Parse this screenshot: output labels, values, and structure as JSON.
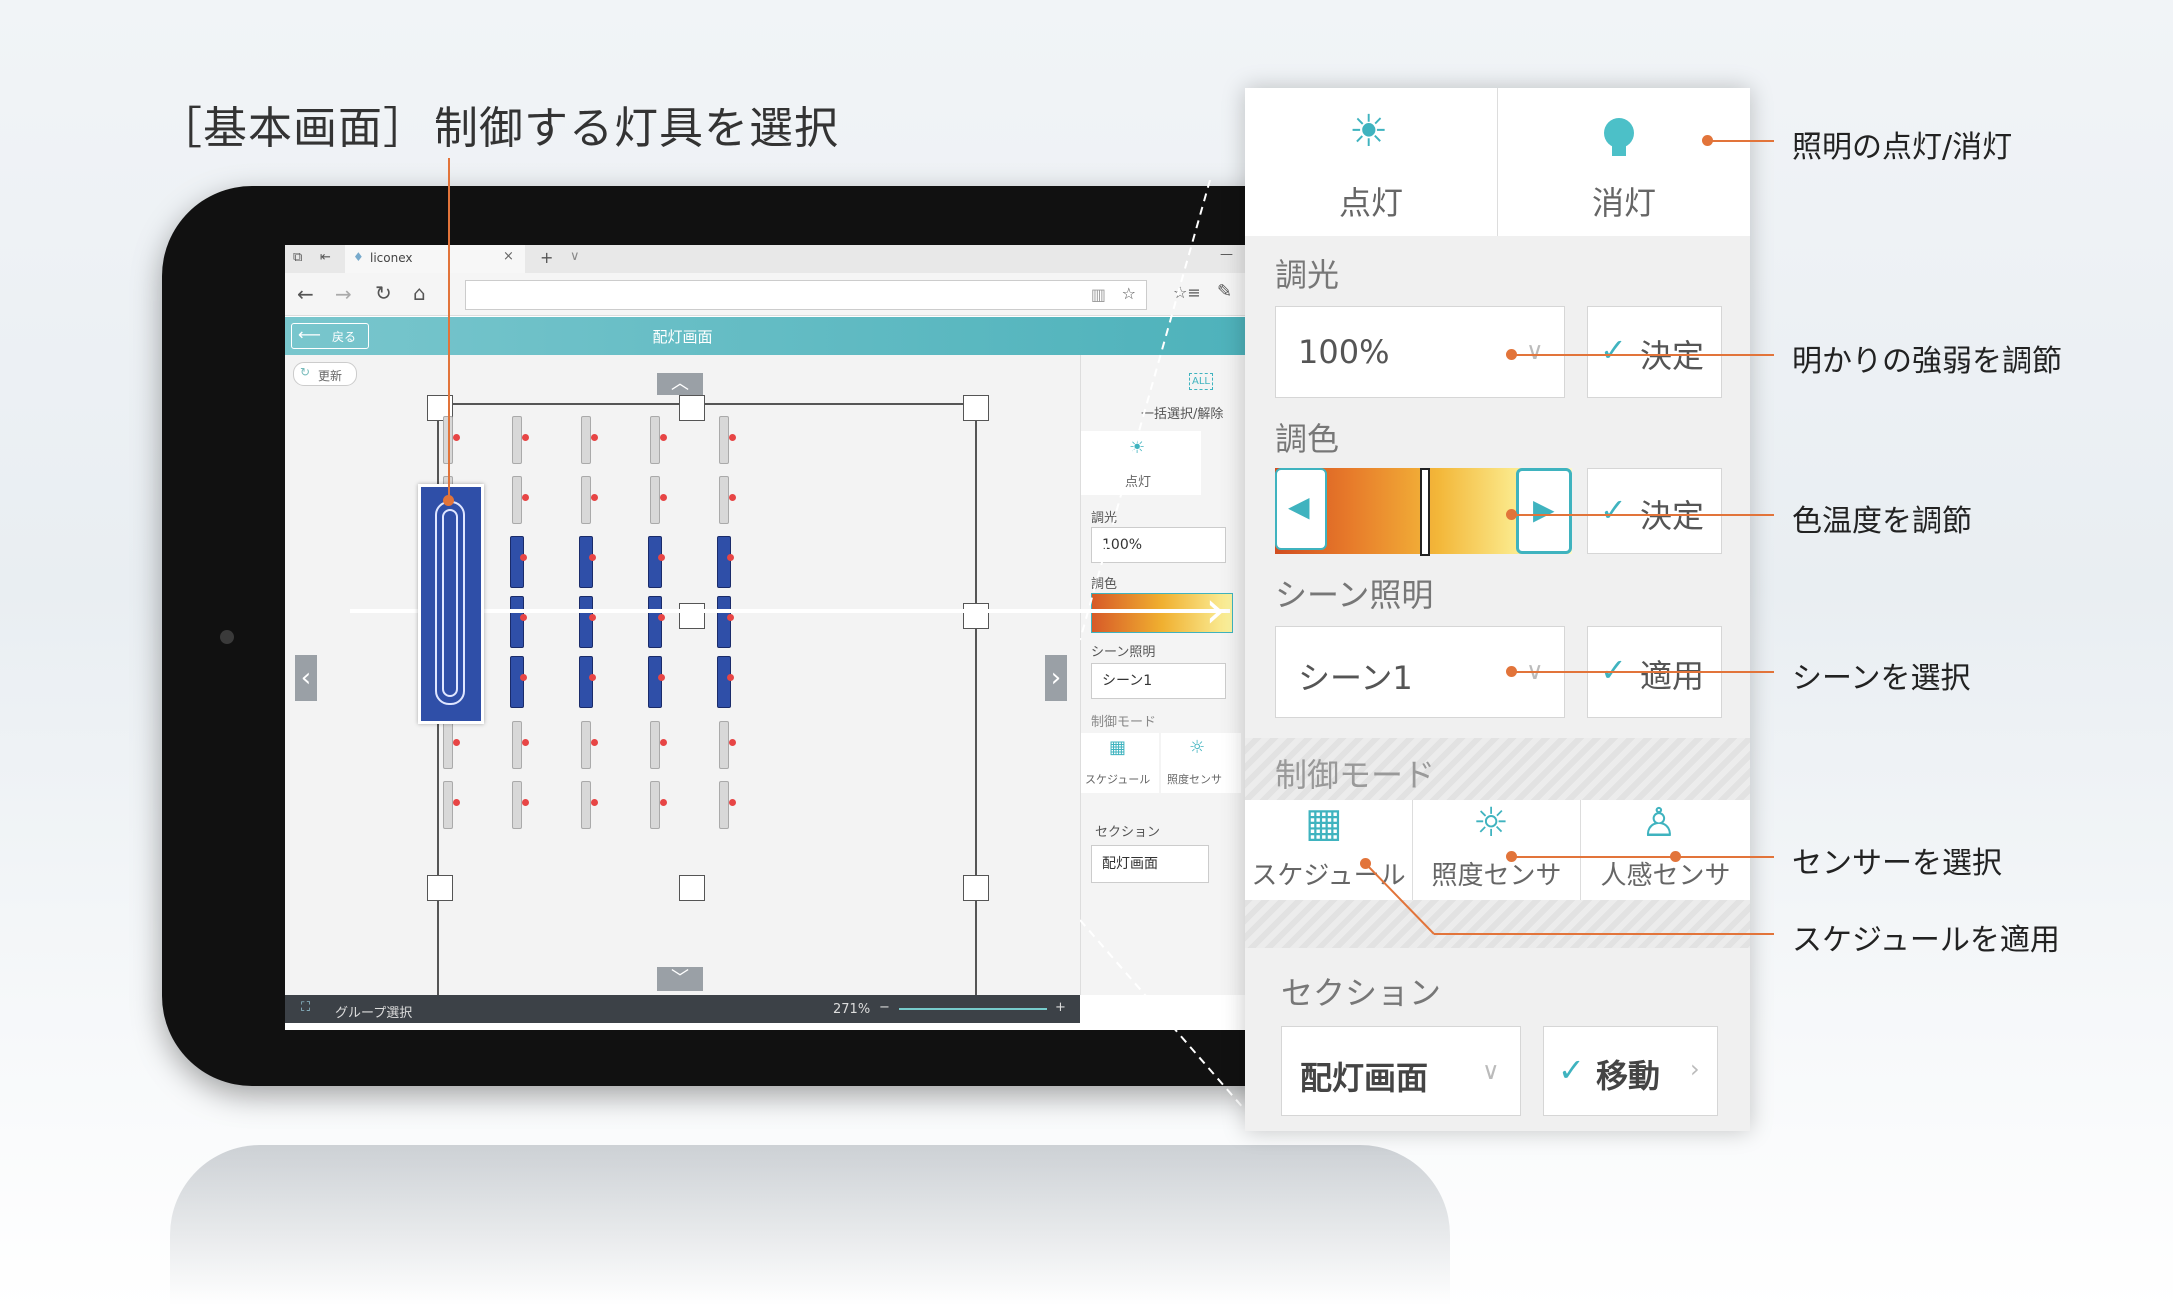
{
  "headings": {
    "screen_label": "［基本画面］",
    "select_fixture": "制御する灯具を選択"
  },
  "browser": {
    "tab_title": "liconex",
    "tab_close": "×",
    "tab_new": "+",
    "tab_more": "∨",
    "nav": {
      "back": "←",
      "forward": "→",
      "refresh": "↻",
      "home": "⌂",
      "star": "☆",
      "favorites": "☆≡",
      "pen": "✎"
    }
  },
  "app": {
    "back_button": "戻る",
    "header_title": "配灯画面",
    "refresh_button": "更新",
    "group_select": "グループ選択",
    "zoom_level": "271%",
    "zoom_minus": "−",
    "zoom_plus": "+",
    "mini_panel": {
      "select_all": "一括選択/解除",
      "all_icon_text": "ALL",
      "light_on": "点灯",
      "dimming_label": "調光",
      "dimming_value": "100%",
      "color_label": "調色",
      "scene_label": "シーン照明",
      "scene_value": "シーン1",
      "mode_label": "制御モード",
      "mode_schedule": "スケジュール",
      "mode_light_sensor": "照度センサ",
      "section_label": "セクション",
      "section_value": "配灯画面"
    }
  },
  "panel": {
    "light_on": "点灯",
    "light_off": "消灯",
    "dimming_label": "調光",
    "dimming_value": "100%",
    "decide_label": "決定",
    "color_label": "調色",
    "color_decide_label": "決定",
    "scene_label": "シーン照明",
    "scene_value": "シーン1",
    "apply_label": "適用",
    "mode_label": "制御モード",
    "mode_schedule": "スケジュール",
    "mode_light_sensor": "照度センサ",
    "mode_motion_sensor": "人感センサ",
    "section_label": "セクション",
    "section_value": "配灯画面",
    "move_label": "移動"
  },
  "annotations": {
    "on_off": "照明の点灯/消灯",
    "brightness": "明かりの強弱を調節",
    "color_temp": "色温度を調節",
    "scene": "シーンを選択",
    "sensor": "センサーを選択",
    "schedule": "スケジュールを適用"
  },
  "colors": {
    "accent": "#3fb3bf",
    "annotation": "#e2743a",
    "fixture_on": "#2f4fa8"
  }
}
